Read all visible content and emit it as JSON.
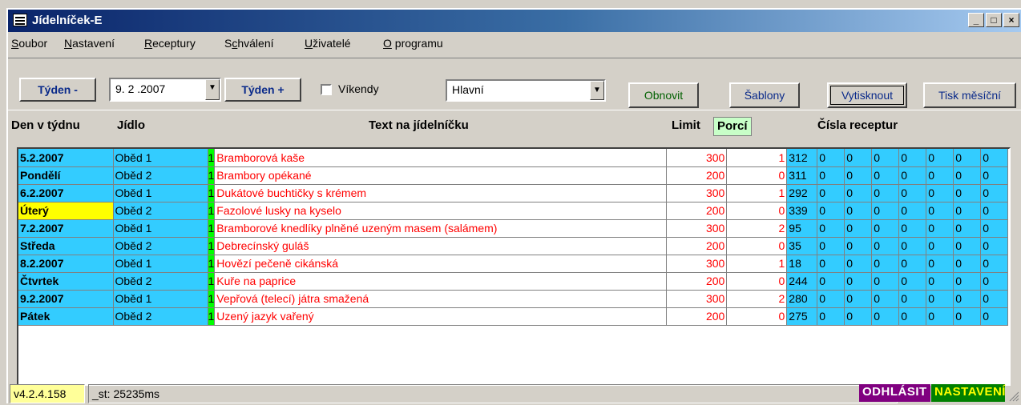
{
  "window": {
    "title": "Jídelníček-E",
    "min": "_",
    "max": "□",
    "close": "×"
  },
  "menu": [
    {
      "pre": "",
      "u": "S",
      "post": "oubor"
    },
    {
      "pre": "",
      "u": "N",
      "post": "astavení"
    },
    {
      "pre": "",
      "u": "R",
      "post": "eceptury"
    },
    {
      "pre": "S",
      "u": "c",
      "post": "hválení"
    },
    {
      "pre": "",
      "u": "U",
      "post": "živatelé"
    },
    {
      "pre": "",
      "u": "O",
      "post": " programu"
    }
  ],
  "toolbar": {
    "week_prev": "Týden -",
    "date": "9. 2 .2007",
    "week_next": "Týden +",
    "weekends_label": "Víkendy",
    "weekends_checked": false,
    "menu_type": "Hlavní",
    "refresh": "Obnovit",
    "templates": "Šablony",
    "print": "Vytisknout",
    "print_monthly": "Tisk měsíční",
    "dropdown_icon": "triangle-down-icon"
  },
  "headers": {
    "day": "Den v týdnu",
    "meal": "Jídlo",
    "text": "Text na jídelníčku",
    "limit": "Limit",
    "portions": "Porcí",
    "recipes": "Čísla receptur"
  },
  "rows": [
    {
      "day": "5.2.2007",
      "meal": "Oběd 1",
      "flag": "1",
      "text": "Bramborová kaše",
      "limit": "300",
      "portions": "1",
      "recipes": [
        "312",
        "0",
        "0",
        "0",
        "0",
        "0",
        "0",
        "0"
      ],
      "highlight": false
    },
    {
      "day": "Pondělí",
      "meal": "Oběd 2",
      "flag": "1",
      "text": "Brambory opékané",
      "limit": "200",
      "portions": "0",
      "recipes": [
        "311",
        "0",
        "0",
        "0",
        "0",
        "0",
        "0",
        "0"
      ],
      "highlight": false
    },
    {
      "day": "6.2.2007",
      "meal": "Oběd 1",
      "flag": "1",
      "text": "Dukátové buchtičky s krémem",
      "limit": "300",
      "portions": "1",
      "recipes": [
        "292",
        "0",
        "0",
        "0",
        "0",
        "0",
        "0",
        "0"
      ],
      "highlight": false
    },
    {
      "day": "Úterý",
      "meal": "Oběd 2",
      "flag": "1",
      "text": "Fazolové lusky na kyselo",
      "limit": "200",
      "portions": "0",
      "recipes": [
        "339",
        "0",
        "0",
        "0",
        "0",
        "0",
        "0",
        "0"
      ],
      "highlight": true
    },
    {
      "day": "7.2.2007",
      "meal": "Oběd 1",
      "flag": "1",
      "text": "Bramborové knedlíky plněné uzeným masem (salámem)",
      "limit": "300",
      "portions": "2",
      "recipes": [
        "95",
        "0",
        "0",
        "0",
        "0",
        "0",
        "0",
        "0"
      ],
      "highlight": false
    },
    {
      "day": "Středa",
      "meal": "Oběd 2",
      "flag": "1",
      "text": "Debrecínský guláš",
      "limit": "200",
      "portions": "0",
      "recipes": [
        "35",
        "0",
        "0",
        "0",
        "0",
        "0",
        "0",
        "0"
      ],
      "highlight": false
    },
    {
      "day": "8.2.2007",
      "meal": "Oběd 1",
      "flag": "1",
      "text": "Hovězí pečeně cikánská",
      "limit": "300",
      "portions": "1",
      "recipes": [
        "18",
        "0",
        "0",
        "0",
        "0",
        "0",
        "0",
        "0"
      ],
      "highlight": false
    },
    {
      "day": "Čtvrtek",
      "meal": "Oběd 2",
      "flag": "1",
      "text": "Kuře na paprice",
      "limit": "200",
      "portions": "0",
      "recipes": [
        "244",
        "0",
        "0",
        "0",
        "0",
        "0",
        "0",
        "0"
      ],
      "highlight": false
    },
    {
      "day": "9.2.2007",
      "meal": "Oběd 1",
      "flag": "1",
      "text": "Vepřová (telecí) játra smažená",
      "limit": "300",
      "portions": "2",
      "recipes": [
        "280",
        "0",
        "0",
        "0",
        "0",
        "0",
        "0",
        "0"
      ],
      "highlight": false
    },
    {
      "day": "Pátek",
      "meal": "Oběd 2",
      "flag": "1",
      "text": "Uzený jazyk vařený",
      "limit": "200",
      "portions": "0",
      "recipes": [
        "275",
        "0",
        "0",
        "0",
        "0",
        "0",
        "0",
        "0"
      ],
      "highlight": false
    }
  ],
  "status": {
    "version": "v4.2.4.158",
    "timing": "_st: 25235ms",
    "logout": "ODHLÁSIT",
    "settings": "NASTAVENÍ"
  },
  "colors": {
    "row_bg": "#33ccff",
    "flag_bg": "#00ff00",
    "highlight": "#ffff00",
    "text_red": "#ff0000",
    "logout_bg": "#800080",
    "settings_bg": "#008000"
  }
}
